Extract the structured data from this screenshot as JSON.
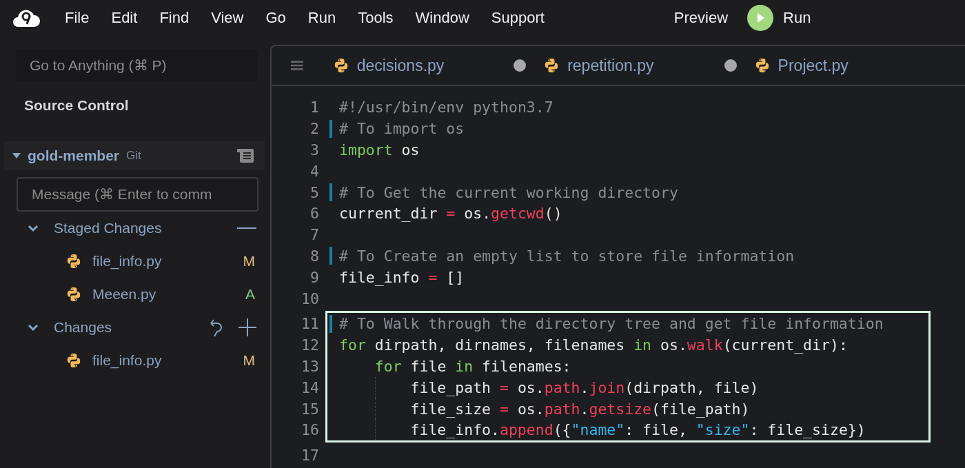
{
  "menu_bar": {
    "items": [
      "File",
      "Edit",
      "Find",
      "View",
      "Go",
      "Run",
      "Tools",
      "Window",
      "Support"
    ],
    "preview": "Preview",
    "run": "Run"
  },
  "sidebar": {
    "search": {
      "placeholder": "Go to Anything (⌘ P)"
    },
    "title": "Source Control",
    "repo": {
      "name": "gold-member",
      "vcs": "Git",
      "expanded": true
    },
    "message": {
      "placeholder": "Message (⌘ Enter to comm"
    },
    "sections": [
      {
        "kind": "staged",
        "label": "Staged Changes",
        "expanded": true,
        "files": [
          {
            "name": "file_info.py",
            "status": "M",
            "color": "#e6c07b"
          },
          {
            "name": "Meeen.py",
            "status": "A",
            "color": "#7fc98a"
          }
        ]
      },
      {
        "kind": "unstaged",
        "label": "Changes",
        "expanded": true,
        "files": [
          {
            "name": "file_info.py",
            "status": "M",
            "color": "#e6c07b"
          }
        ]
      }
    ]
  },
  "editor": {
    "tabs": [
      {
        "label": "decisions.py",
        "modified": true
      },
      {
        "label": "repetition.py",
        "modified": true
      },
      {
        "label": "Project.py",
        "modified": false
      }
    ],
    "blocks": [
      {
        "highlighted": false,
        "lines": [
          {
            "number": "1",
            "changed": false,
            "tokens": [
              {
                "kind": "comment",
                "text": "#!/usr/bin/env python3.7"
              }
            ]
          },
          {
            "number": "2",
            "changed": true,
            "tokens": [
              {
                "kind": "comment",
                "text": "# To import os"
              }
            ]
          },
          {
            "number": "3",
            "changed": false,
            "tokens": [
              {
                "kind": "keyword",
                "text": "import"
              },
              {
                "kind": "plain",
                "text": " os"
              }
            ]
          },
          {
            "number": "4",
            "changed": false
          },
          {
            "number": "5",
            "changed": true,
            "tokens": [
              {
                "kind": "comment",
                "text": "# To Get the current working directory"
              }
            ]
          },
          {
            "number": "6",
            "changed": false,
            "tokens": [
              {
                "kind": "plain",
                "text": "current_dir "
              },
              {
                "kind": "operator",
                "text": "="
              },
              {
                "kind": "plain",
                "text": " os."
              },
              {
                "kind": "function",
                "text": "getcwd"
              },
              {
                "kind": "plain",
                "text": "()"
              }
            ]
          },
          {
            "number": "7",
            "changed": false
          },
          {
            "number": "8",
            "changed": true,
            "tokens": [
              {
                "kind": "comment",
                "text": "# To Create an empty list to store file information"
              }
            ]
          },
          {
            "number": "9",
            "changed": false,
            "tokens": [
              {
                "kind": "plain",
                "text": "file_info "
              },
              {
                "kind": "operator",
                "text": "="
              },
              {
                "kind": "plain",
                "text": " []"
              }
            ]
          },
          {
            "number": "10",
            "changed": false
          }
        ]
      },
      {
        "highlighted": true,
        "lines": [
          {
            "number": "11",
            "changed": true,
            "tokens": [
              {
                "kind": "comment",
                "text": "# To Walk through the directory tree and get file information"
              }
            ]
          },
          {
            "number": "12",
            "changed": false,
            "tokens": [
              {
                "kind": "keyword",
                "text": "for"
              },
              {
                "kind": "plain",
                "text": " dirpath, dirnames, filenames "
              },
              {
                "kind": "keyword",
                "text": "in"
              },
              {
                "kind": "plain",
                "text": " os."
              },
              {
                "kind": "function",
                "text": "walk"
              },
              {
                "kind": "plain",
                "text": "(current_dir):"
              }
            ],
            "children": [
              {
                "number": "13",
                "changed": false,
                "tokens": [
                  {
                    "kind": "keyword",
                    "text": "for"
                  },
                  {
                    "kind": "plain",
                    "text": " file "
                  },
                  {
                    "kind": "keyword",
                    "text": "in"
                  },
                  {
                    "kind": "plain",
                    "text": " filenames:"
                  }
                ],
                "children": [
                  {
                    "number": "14",
                    "changed": false,
                    "tokens": [
                      {
                        "kind": "plain",
                        "text": "file_path "
                      },
                      {
                        "kind": "operator",
                        "text": "="
                      },
                      {
                        "kind": "plain",
                        "text": " os."
                      },
                      {
                        "kind": "function",
                        "text": "path"
                      },
                      {
                        "kind": "plain",
                        "text": "."
                      },
                      {
                        "kind": "function",
                        "text": "join"
                      },
                      {
                        "kind": "plain",
                        "text": "(dirpath, file)"
                      }
                    ]
                  },
                  {
                    "number": "15",
                    "changed": false,
                    "tokens": [
                      {
                        "kind": "plain",
                        "text": "file_size "
                      },
                      {
                        "kind": "operator",
                        "text": "="
                      },
                      {
                        "kind": "plain",
                        "text": " os."
                      },
                      {
                        "kind": "function",
                        "text": "path"
                      },
                      {
                        "kind": "plain",
                        "text": "."
                      },
                      {
                        "kind": "function",
                        "text": "getsize"
                      },
                      {
                        "kind": "plain",
                        "text": "(file_path)"
                      }
                    ]
                  },
                  {
                    "number": "16",
                    "changed": false,
                    "tokens": [
                      {
                        "kind": "plain",
                        "text": "file_info."
                      },
                      {
                        "kind": "function",
                        "text": "append"
                      },
                      {
                        "kind": "plain",
                        "text": "({"
                      },
                      {
                        "kind": "string",
                        "text": "\"name\""
                      },
                      {
                        "kind": "plain",
                        "text": ": file, "
                      },
                      {
                        "kind": "string",
                        "text": "\"size\""
                      },
                      {
                        "kind": "plain",
                        "text": ": file_size})"
                      }
                    ]
                  }
                ]
              }
            ]
          }
        ]
      },
      {
        "highlighted": false,
        "lines": [
          {
            "number": "17",
            "changed": false
          }
        ]
      }
    ]
  }
}
